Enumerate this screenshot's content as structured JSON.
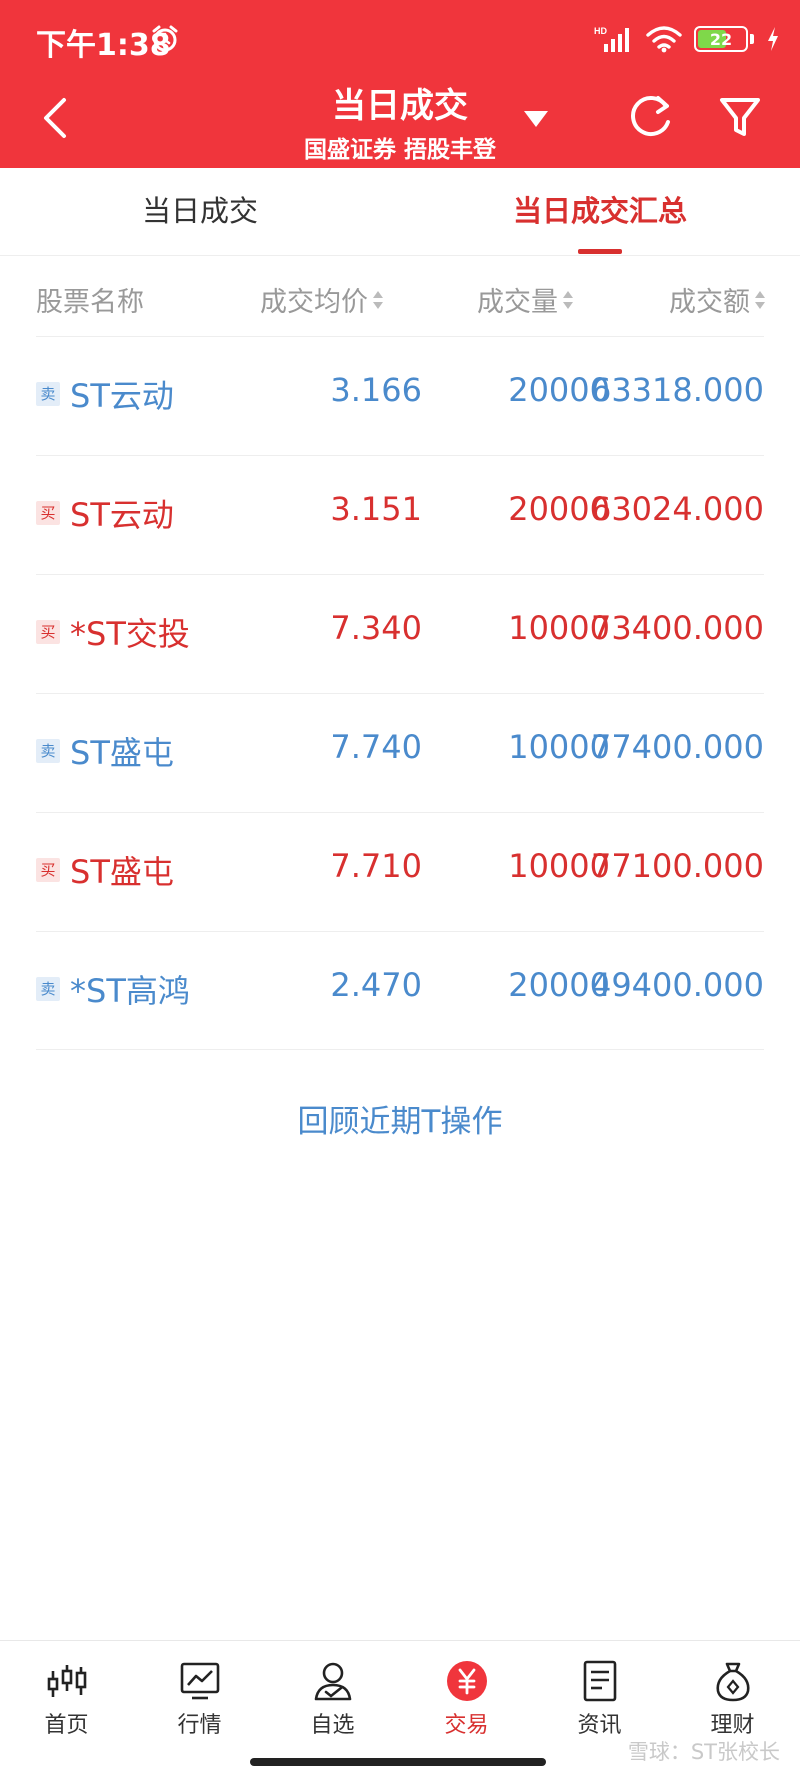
{
  "status": {
    "time": "下午1:38",
    "battery": "22"
  },
  "header": {
    "title": "当日成交",
    "subtitle": "国盛证券 捂股丰登"
  },
  "tabs": [
    {
      "label": "当日成交"
    },
    {
      "label": "当日成交汇总"
    }
  ],
  "columns": [
    "股票名称",
    "成交均价",
    "成交量",
    "成交额"
  ],
  "rows": [
    {
      "side": "卖",
      "name": "ST云动",
      "price": "3.166",
      "volume": "20000",
      "amount": "63318.000"
    },
    {
      "side": "买",
      "name": "ST云动",
      "price": "3.151",
      "volume": "20000",
      "amount": "63024.000"
    },
    {
      "side": "买",
      "name": "*ST交投",
      "price": "7.340",
      "volume": "10000",
      "amount": "73400.000"
    },
    {
      "side": "卖",
      "name": "ST盛屯",
      "price": "7.740",
      "volume": "10000",
      "amount": "77400.000"
    },
    {
      "side": "买",
      "name": "ST盛屯",
      "price": "7.710",
      "volume": "10000",
      "amount": "77100.000"
    },
    {
      "side": "卖",
      "name": "*ST高鸿",
      "price": "2.470",
      "volume": "20000",
      "amount": "49400.000"
    }
  ],
  "review_link": "回顾近期T操作",
  "nav": [
    {
      "label": "首页",
      "icon": "candlestick-icon"
    },
    {
      "label": "行情",
      "icon": "chart-icon"
    },
    {
      "label": "自选",
      "icon": "person-icon"
    },
    {
      "label": "交易",
      "icon": "yuan-icon"
    },
    {
      "label": "资讯",
      "icon": "document-icon"
    },
    {
      "label": "理财",
      "icon": "money-bag-icon"
    }
  ],
  "watermark": "雪球：ST张校长",
  "colors": {
    "brand": "#f0353c",
    "sell": "#4a8acc",
    "buy": "#d8302f"
  }
}
